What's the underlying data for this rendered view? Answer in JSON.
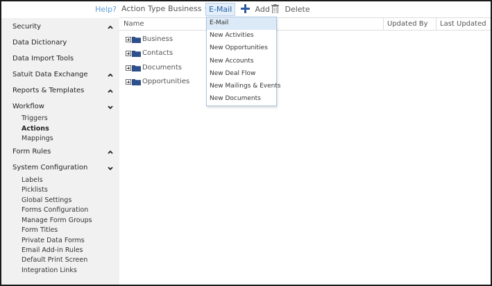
{
  "sidebar": {
    "help": "Help?",
    "sections": [
      {
        "label": "Security",
        "chevron": "chevron-up-icon"
      },
      {
        "label": "Data Dictionary"
      },
      {
        "label": "Data Import Tools"
      },
      {
        "label": "Satuit Data Exchange",
        "chevron": "chevron-up-icon"
      },
      {
        "label": "Reports & Templates",
        "chevron": "chevron-up-icon"
      },
      {
        "label": "Workflow",
        "chevron": "chevron-down-icon"
      },
      {
        "label": "Form Rules",
        "chevron": "chevron-up-icon"
      },
      {
        "label": "System Configuration",
        "chevron": "chevron-down-icon"
      }
    ],
    "workflow_items": [
      "Triggers",
      "Actions",
      "Mappings"
    ],
    "active_workflow_item": "Actions",
    "sysconfig_items": [
      "Labels",
      "Picklists",
      "Global Settings",
      "Forms Configuration",
      "Manage Form Groups",
      "Form Titles",
      "Private Data Forms",
      "Email Add-in Rules",
      "Default Print Screen",
      "Integration Links"
    ]
  },
  "toolbar": {
    "action_type_label": "Action Type :",
    "business_dd": "Business",
    "email_dd": "E-Mail",
    "add_label": "Add",
    "delete_label": "Delete"
  },
  "table": {
    "columns": [
      "Name",
      "Updated By",
      "Last Updated"
    ],
    "folders": [
      "Business",
      "Contacts",
      "Documents",
      "Opportunities"
    ]
  },
  "dropdown": {
    "items": [
      "E-Mail",
      "New Activities",
      "New Opportunities",
      "New Accounts",
      "New Deal Flow",
      "New Mailings & Events",
      "New Documents"
    ],
    "selected": "E-Mail"
  },
  "colors": {
    "accent": "#1f5fa8",
    "folder": "#2d4f8a",
    "sidebar_bg": "#f1f1f1",
    "selected_bg": "#dce9f6"
  }
}
